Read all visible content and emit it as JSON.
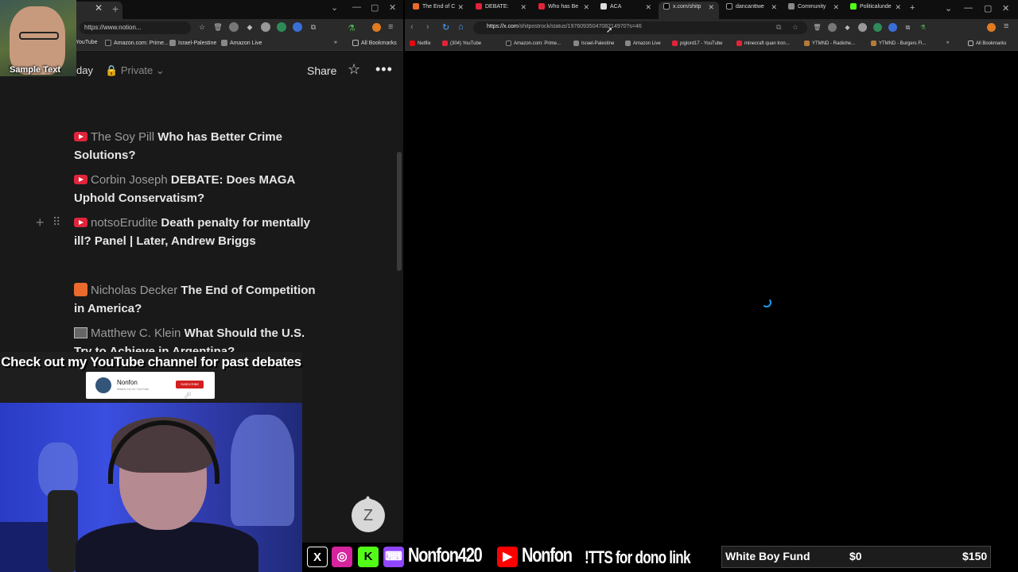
{
  "left_browser": {
    "url": "https://www.notion...",
    "bookmarks": [
      "YouTube",
      "Amazon.com: Prime...",
      "Israel-Palestine",
      "Amazon Live"
    ],
    "all_bookmarks_label": "All Bookmarks"
  },
  "notion": {
    "page_title_fragment": "day",
    "privacy": "Private",
    "share_label": "Share",
    "entries": [
      {
        "type": "youtube",
        "source": "The Soy Pill",
        "title": "Who has Better Crime Solutions?"
      },
      {
        "type": "youtube",
        "source": "Corbin Joseph",
        "title": "DEBATE: Does MAGA Uphold Conservatism?"
      },
      {
        "type": "youtube",
        "source": "notsoErudite",
        "title": "Death penalty for mentally ill? Panel | Later, Andrew Briggs"
      },
      {
        "type": "substack",
        "source": "Nicholas Decker",
        "title": "The End of Competition in America?"
      },
      {
        "type": "book",
        "source": "Matthew C. Klein",
        "title": "What Should the U.S. Try to Achieve in Argentina?"
      }
    ]
  },
  "overlay": {
    "sample_text": "Sample Text",
    "promo_text": "Check out my YouTube channel for past debates",
    "yt_card_name": "Nonfon",
    "yt_card_sub": "Watch me on YouTube",
    "yt_card_button": "SUBSCRIBE"
  },
  "right_browser": {
    "tabs": [
      "The End of C",
      "DEBATE: ",
      "Who has Be",
      "ACA",
      "x.com/shitp",
      "dancanttwe",
      "Community",
      "Politicalunde"
    ],
    "active_tab_index": 4,
    "url_host": "https://x.com",
    "url_path": "/shitpostrock/status/1976093504708214970?s=46",
    "bookmarks": [
      "Netflix",
      "(304) YouTube",
      "Amazon.com: Prime...",
      "Israel-Palestine",
      "Amazon Live",
      "piglord17 - YouTube",
      "minecraft quan tron...",
      "YTMND - Radiohe...",
      "YTMND - Burgers Fl..."
    ],
    "all_bookmarks_label": "All Bookmarks",
    "spinner_color": "#1d9bf0"
  },
  "stream_bar": {
    "twitch_name": "Nonfon420",
    "youtube_name": "Nonfon",
    "tts_text": "!TTS for dono link",
    "fund": {
      "label": "White Boy Fund",
      "current": "$0",
      "goal": "$150"
    }
  }
}
